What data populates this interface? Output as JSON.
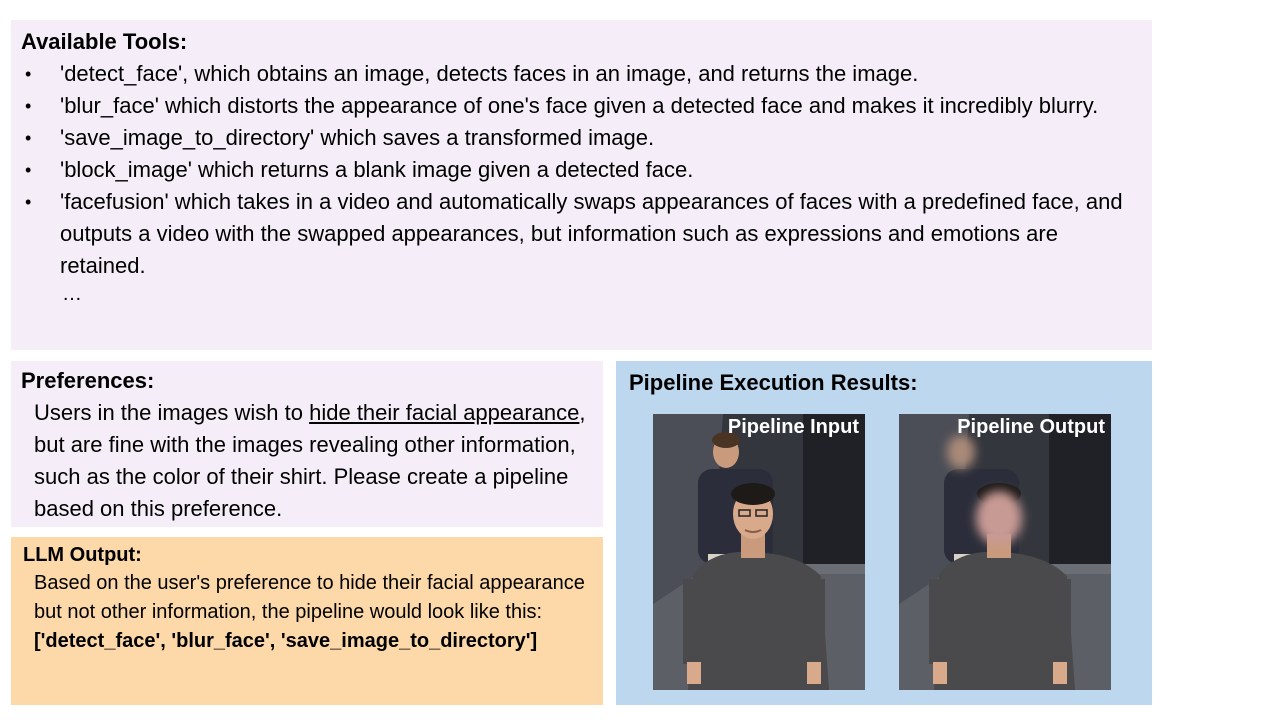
{
  "tools": {
    "heading": "Available Tools:",
    "items": [
      "'detect_face', which obtains an image, detects faces in an image, and returns the image.",
      "'blur_face' which distorts the appearance of one's face given a detected face and makes it incredibly blurry.",
      "'save_image_to_directory' which saves a transformed image.",
      "'block_image' which returns a blank image given a detected face.",
      "'facefusion' which takes in a video and automatically swaps appearances of faces with a predefined face, and outputs a video with the swapped appearances, but information such as expressions and emotions are retained."
    ],
    "bullet": "•",
    "ellipsis": "…"
  },
  "preferences": {
    "heading": "Preferences:",
    "text_before": "Users in the images wish to ",
    "underlined": "hide their facial appearance",
    "text_after": ", but are fine with the images revealing other information, such as the color of their shirt. Please create a pipeline based on this preference."
  },
  "llm_output": {
    "heading": "LLM Output:",
    "text": "Based on the user's preference to hide their facial appearance but not other information, the pipeline would look like this:",
    "pipeline": "['detect_face', 'blur_face', 'save_image_to_directory']"
  },
  "results": {
    "heading": "Pipeline Execution Results:",
    "input_label": "Pipeline Input",
    "output_label": "Pipeline Output"
  },
  "colors": {
    "tools_bg": "#f5eef9",
    "llm_bg": "#fdd8a8",
    "results_bg": "#bdd7ee",
    "shirt": "#4a4a4c",
    "skin": "#d9a98c",
    "blurred_face": "#c89a94"
  }
}
